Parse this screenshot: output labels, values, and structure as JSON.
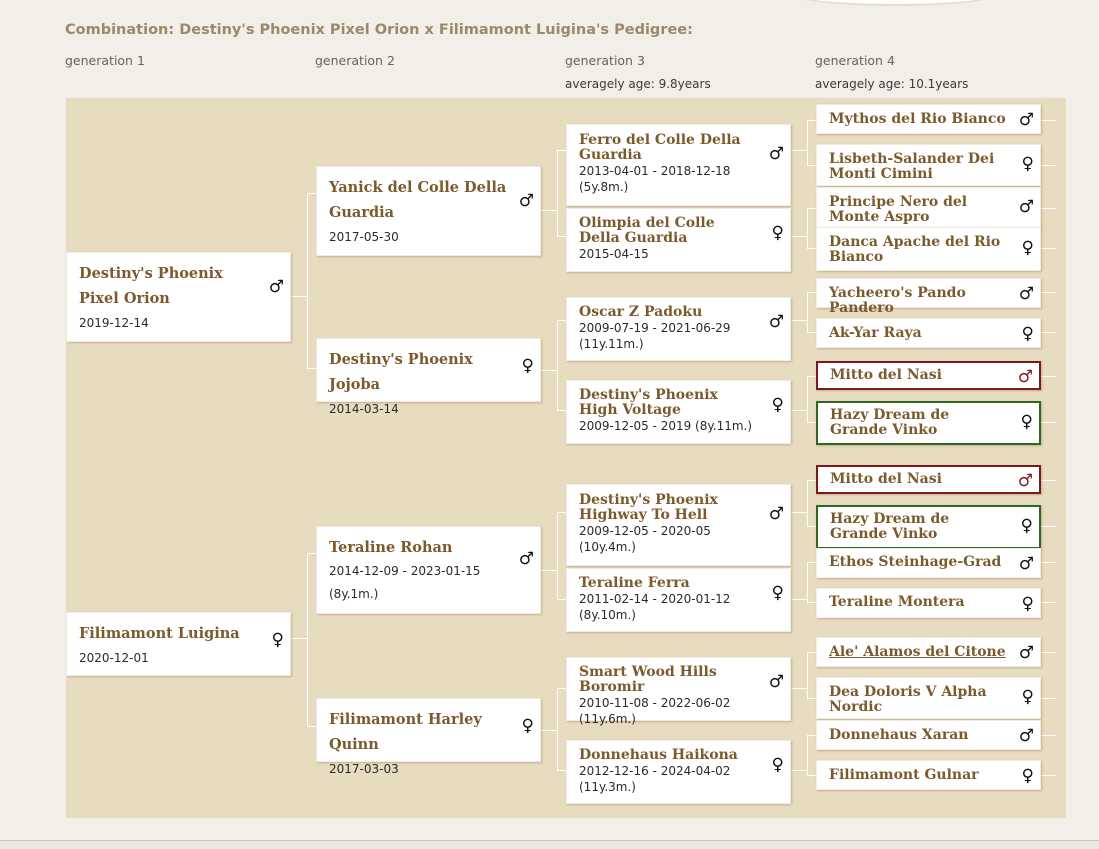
{
  "title": "Combination: Destiny's Phoenix Pixel Orion x Filimamont Luigina's Pedigree:",
  "headers": {
    "gen1": "generation 1",
    "gen2": "generation 2",
    "gen3": "generation 3",
    "gen4": "generation 4",
    "avg3": "averagely age: 9.8years",
    "avg4": "averagely age: 10.1years"
  },
  "symbols": {
    "male": "♂",
    "female": "♀"
  },
  "nodes": {
    "g1_sire": {
      "name": "Destiny's Phoenix Pixel Orion",
      "dates": "2019-12-14",
      "sex": "male"
    },
    "g1_dam": {
      "name": "Filimamont Luigina",
      "dates": "2020-12-01",
      "sex": "female"
    },
    "g2_ss": {
      "name": "Yanick del Colle Della Guardia",
      "dates": "2017-05-30",
      "sex": "male"
    },
    "g2_sd": {
      "name": "Destiny's Phoenix Jojoba",
      "dates": "2014-03-14",
      "sex": "female"
    },
    "g2_ds": {
      "name": "Teraline Rohan",
      "dates": "2014-12-09 - 2023-01-15",
      "age": "(8y.1m.)",
      "sex": "male"
    },
    "g2_dd": {
      "name": "Filimamont Harley Quinn",
      "dates": "2017-03-03",
      "sex": "female"
    },
    "g3_1": {
      "name": "Ferro del Colle Della Guardia",
      "dates": "2013-04-01 - 2018-12-18",
      "age": "(5y.8m.)",
      "sex": "male"
    },
    "g3_2": {
      "name": "Olimpia del Colle Della Guardia",
      "dates": "2015-04-15",
      "sex": "female"
    },
    "g3_3": {
      "name": "Oscar Z Padoku",
      "dates": "2009-07-19 - 2021-06-29",
      "age": "(11y.11m.)",
      "sex": "male"
    },
    "g3_4": {
      "name": "Destiny's Phoenix High Voltage",
      "dates": "2009-12-05 - 2019 (8y.11m.)",
      "sex": "female"
    },
    "g3_5": {
      "name": "Destiny's Phoenix Highway To Hell",
      "dates": "2009-12-05 - 2020-05",
      "age": "(10y.4m.)",
      "sex": "male"
    },
    "g3_6": {
      "name": "Teraline Ferra",
      "dates": "2011-02-14 - 2020-01-12",
      "age": "(8y.10m.)",
      "sex": "female"
    },
    "g3_7": {
      "name": "Smart Wood Hills Boromir",
      "dates": "2010-11-08 - 2022-06-02",
      "age": "(11y.6m.)",
      "sex": "male"
    },
    "g3_8": {
      "name": "Donnehaus Haikona",
      "dates": "2012-12-16 - 2024-04-02",
      "age": "(11y.3m.)",
      "sex": "female"
    },
    "g4_1": {
      "name": "Mythos del Rio Bianco",
      "sex": "male"
    },
    "g4_2": {
      "name": "Lisbeth-Salander Dei Monti Cimini",
      "sex": "female"
    },
    "g4_3": {
      "name": "Principe Nero del Monte Aspro",
      "sex": "male"
    },
    "g4_4": {
      "name": "Danca Apache del Rio Bianco",
      "sex": "female"
    },
    "g4_5": {
      "name": "Yacheero's Pando Pandero",
      "sex": "male"
    },
    "g4_6": {
      "name": "Ak-Yar Raya",
      "sex": "female"
    },
    "g4_7": {
      "name": "Mitto del Nasi",
      "sex": "male",
      "highlight": "red"
    },
    "g4_8": {
      "name": "Hazy Dream de Grande Vinko",
      "sex": "female",
      "highlight": "green"
    },
    "g4_9": {
      "name": "Mitto del Nasi",
      "sex": "male",
      "highlight": "red"
    },
    "g4_10": {
      "name": "Hazy Dream de Grande Vinko",
      "sex": "female",
      "highlight": "green"
    },
    "g4_11": {
      "name": "Ethos Steinhage-Grad",
      "sex": "male"
    },
    "g4_12": {
      "name": "Teraline Montera",
      "sex": "female"
    },
    "g4_13": {
      "name": "Ale' Alamos del Citone",
      "sex": "male"
    },
    "g4_14": {
      "name": "Dea Doloris V Alpha Nordic",
      "sex": "female"
    },
    "g4_15": {
      "name": "Donnehaus Xaran",
      "sex": "male"
    },
    "g4_16": {
      "name": "Filimamont Gulnar",
      "sex": "female"
    }
  }
}
